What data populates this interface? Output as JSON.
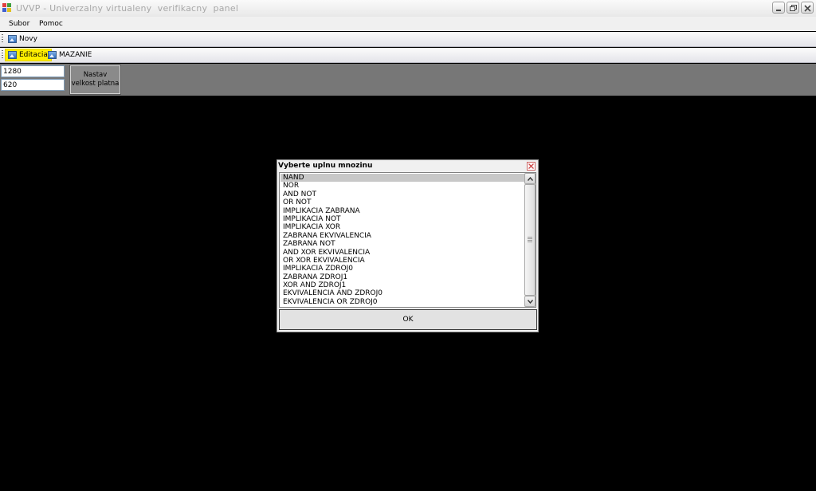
{
  "window": {
    "title": "UVVP - Univerzalny virtualeny  verifikacny  panel",
    "controls": [
      "minimize-icon",
      "restore-icon",
      "close-icon"
    ]
  },
  "menu": {
    "items": [
      {
        "label": "Subor"
      },
      {
        "label": "Pomoc"
      }
    ]
  },
  "toolbar1": {
    "items": [
      {
        "label": "Novy",
        "icon": "picture-icon"
      }
    ]
  },
  "toolbar2": {
    "items": [
      {
        "label": "Editacia",
        "icon": "picture-icon",
        "active": true
      },
      {
        "label": "MAZANIE",
        "icon": "picture-icon",
        "active": false
      }
    ]
  },
  "canvas_panel": {
    "width_value": "1280",
    "height_value": "620",
    "set_button_line1": "Nastav",
    "set_button_line2": "velkost platna"
  },
  "dialog": {
    "title": "Vyberte uplnu mnozinu",
    "items": [
      "NAND",
      "NOR",
      "AND NOT",
      "OR NOT",
      "IMPLIKACIA ZABRANA",
      "IMPLIKACIA NOT",
      "IMPLIKACIA XOR",
      "ZABRANA EKVIVALENCIA",
      "ZABRANA NOT",
      "AND XOR EKVIVALENCIA",
      "OR XOR EKVIVALENCIA",
      "IMPLIKACIA ZDROJ0",
      "ZABRANA ZDROJ1",
      "XOR AND ZDROJ1",
      "EKVIVALENCIA AND ZDROJ0",
      "EKVIVALENCIA OR ZDROJ0"
    ],
    "selected_index": 0,
    "ok_label": "OK"
  },
  "colors": {
    "active_tool": "#ffee00",
    "panel_bg": "#777777",
    "workspace_bg": "#000000",
    "selection": "#c8c8c8"
  }
}
